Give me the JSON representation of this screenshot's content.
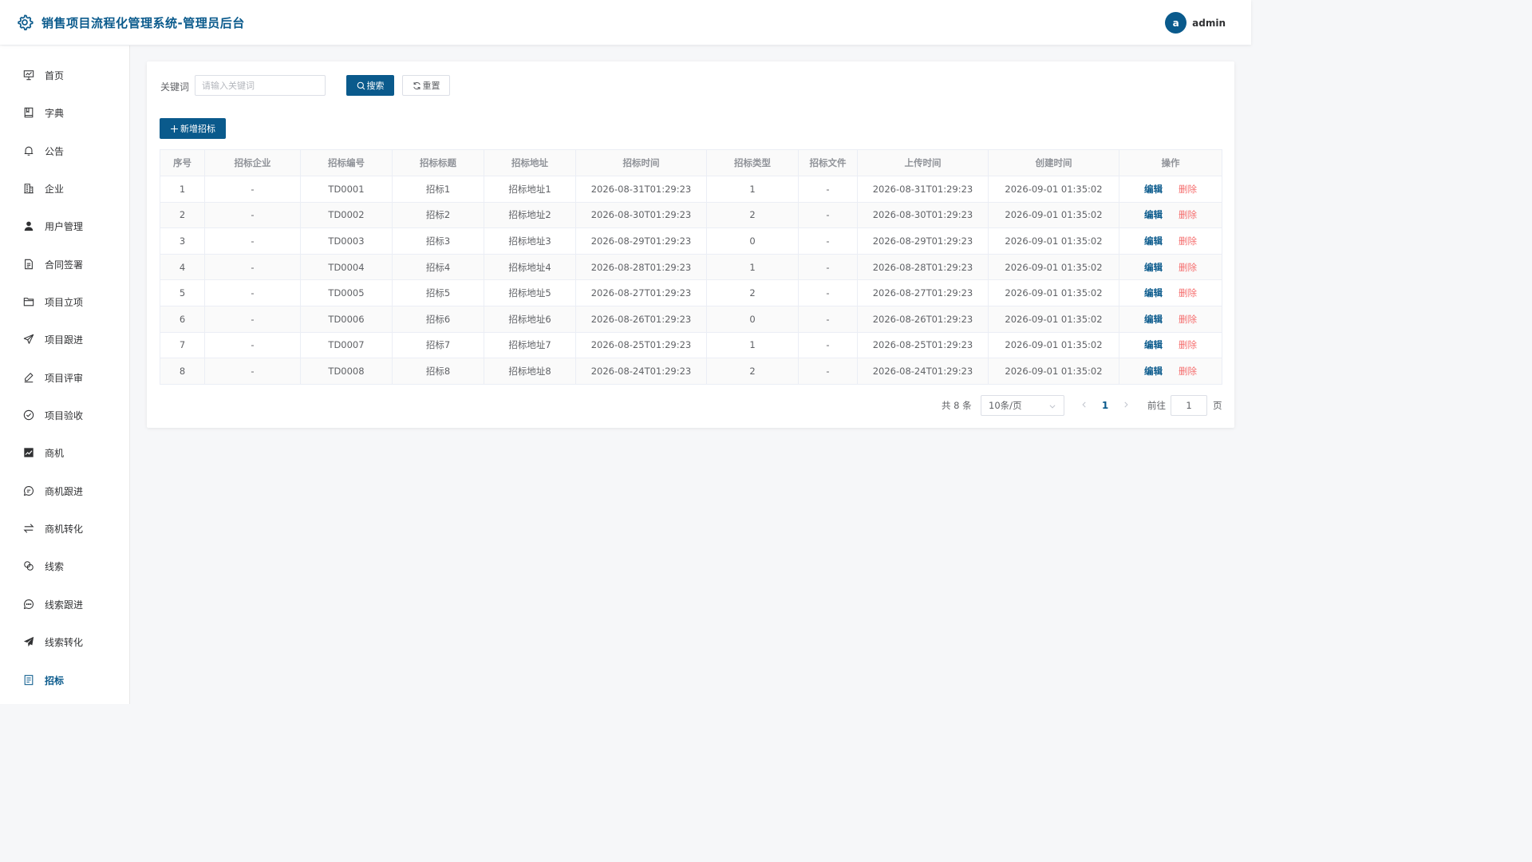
{
  "app": {
    "title": "销售项目流程化管理系统-管理员后台"
  },
  "user": {
    "avatar_letter": "a",
    "name": "admin"
  },
  "sidebar": {
    "items": [
      {
        "label": "首页",
        "icon": "presentation-icon"
      },
      {
        "label": "字典",
        "icon": "book-icon"
      },
      {
        "label": "公告",
        "icon": "bell-icon"
      },
      {
        "label": "企业",
        "icon": "office-building-icon"
      },
      {
        "label": "用户管理",
        "icon": "user-icon"
      },
      {
        "label": "合同签署",
        "icon": "document-icon"
      },
      {
        "label": "项目立项",
        "icon": "folder-icon"
      },
      {
        "label": "项目跟进",
        "icon": "send-icon"
      },
      {
        "label": "项目评审",
        "icon": "edit-pen-icon"
      },
      {
        "label": "项目验收",
        "icon": "check-circle-icon"
      },
      {
        "label": "商机",
        "icon": "trend-chart-icon"
      },
      {
        "label": "商机跟进",
        "icon": "chat-icon"
      },
      {
        "label": "商机转化",
        "icon": "swap-icon"
      },
      {
        "label": "线索",
        "icon": "link-icon"
      },
      {
        "label": "线索跟进",
        "icon": "chat-dots-icon"
      },
      {
        "label": "线索转化",
        "icon": "paper-plane-icon"
      },
      {
        "label": "招标",
        "icon": "tickets-icon",
        "active": true
      }
    ]
  },
  "search": {
    "label": "关键词",
    "placeholder": "请输入关键词",
    "value": "",
    "search_button": "搜索",
    "reset_button": "重置"
  },
  "toolbar": {
    "add_button": "新增招标"
  },
  "table": {
    "headers": [
      "序号",
      "招标企业",
      "招标编号",
      "招标标题",
      "招标地址",
      "招标时间",
      "招标类型",
      "招标文件",
      "上传时间",
      "创建时间",
      "操作"
    ],
    "rows": [
      [
        "1",
        "-",
        "TD0001",
        "招标1",
        "招标地址1",
        "2026-08-31T01:29:23",
        "1",
        "-",
        "2026-08-31T01:29:23",
        "2026-09-01 01:35:02"
      ],
      [
        "2",
        "-",
        "TD0002",
        "招标2",
        "招标地址2",
        "2026-08-30T01:29:23",
        "2",
        "-",
        "2026-08-30T01:29:23",
        "2026-09-01 01:35:02"
      ],
      [
        "3",
        "-",
        "TD0003",
        "招标3",
        "招标地址3",
        "2026-08-29T01:29:23",
        "0",
        "-",
        "2026-08-29T01:29:23",
        "2026-09-01 01:35:02"
      ],
      [
        "4",
        "-",
        "TD0004",
        "招标4",
        "招标地址4",
        "2026-08-28T01:29:23",
        "1",
        "-",
        "2026-08-28T01:29:23",
        "2026-09-01 01:35:02"
      ],
      [
        "5",
        "-",
        "TD0005",
        "招标5",
        "招标地址5",
        "2026-08-27T01:29:23",
        "2",
        "-",
        "2026-08-27T01:29:23",
        "2026-09-01 01:35:02"
      ],
      [
        "6",
        "-",
        "TD0006",
        "招标6",
        "招标地址6",
        "2026-08-26T01:29:23",
        "0",
        "-",
        "2026-08-26T01:29:23",
        "2026-09-01 01:35:02"
      ],
      [
        "7",
        "-",
        "TD0007",
        "招标7",
        "招标地址7",
        "2026-08-25T01:29:23",
        "1",
        "-",
        "2026-08-25T01:29:23",
        "2026-09-01 01:35:02"
      ],
      [
        "8",
        "-",
        "TD0008",
        "招标8",
        "招标地址8",
        "2026-08-24T01:29:23",
        "2",
        "-",
        "2026-08-24T01:29:23",
        "2026-09-01 01:35:02"
      ]
    ],
    "edit_label": "编辑",
    "delete_label": "删除"
  },
  "pagination": {
    "total_text": "共 8 条",
    "page_size": "10条/页",
    "current_page": "1",
    "goto_label": "前往",
    "goto_value": "1",
    "page_suffix": "页"
  },
  "colors": {
    "brand": "#0a5a8c",
    "danger": "#f56c6c"
  }
}
